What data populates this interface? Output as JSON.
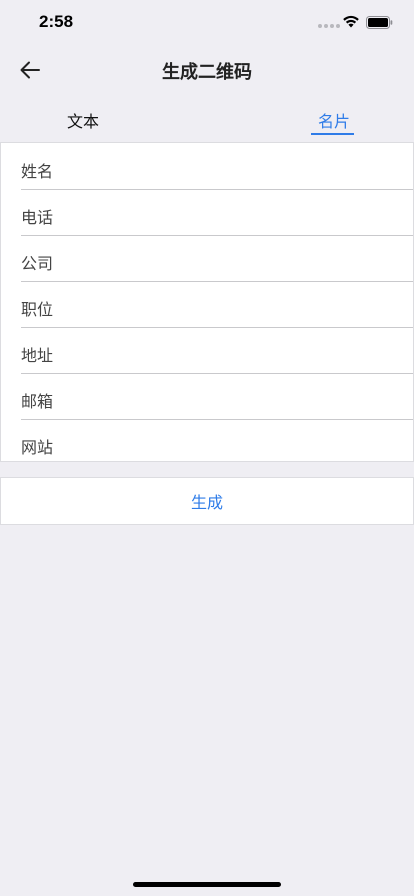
{
  "status_bar": {
    "time": "2:58"
  },
  "nav": {
    "title": "生成二维码",
    "back_icon": "arrow-left-icon"
  },
  "tabs": [
    {
      "label": "文本",
      "active": false
    },
    {
      "label": "名片",
      "active": true
    }
  ],
  "form": {
    "fields": [
      {
        "placeholder": "姓名",
        "value": ""
      },
      {
        "placeholder": "电话",
        "value": ""
      },
      {
        "placeholder": "公司",
        "value": ""
      },
      {
        "placeholder": "职位",
        "value": ""
      },
      {
        "placeholder": "地址",
        "value": ""
      },
      {
        "placeholder": "邮箱",
        "value": ""
      },
      {
        "placeholder": "网站",
        "value": ""
      }
    ]
  },
  "actions": {
    "generate_label": "生成"
  },
  "colors": {
    "accent": "#2f7ce8",
    "background": "#efeef3"
  }
}
